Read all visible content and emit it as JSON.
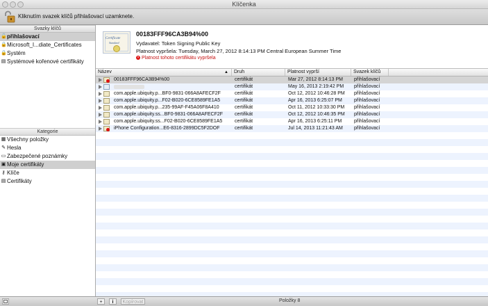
{
  "window": {
    "title": "Klíčenka"
  },
  "toolbar": {
    "lock_text": "Kliknutím svazek klíčů přihlašovací uzamknete."
  },
  "keychains": {
    "header": "Svazky klíčů",
    "items": [
      {
        "label": "přihlašovací",
        "icon": "keychain-lock-icon"
      },
      {
        "label": "Microsoft_I...diate_Certificates",
        "icon": "keychain-lock-icon"
      },
      {
        "label": "Systém",
        "icon": "keychain-lock-icon"
      },
      {
        "label": "Systémové kořenové certifikáty",
        "icon": "folder-icon"
      }
    ]
  },
  "categories": {
    "header": "Kategorie",
    "items": [
      {
        "label": "Všechny položky",
        "icon": "all-items-icon"
      },
      {
        "label": "Hesla",
        "icon": "password-icon"
      },
      {
        "label": "Zabezpečené poznámky",
        "icon": "note-icon"
      },
      {
        "label": "Moje certifikáty",
        "icon": "my-certificates-icon"
      },
      {
        "label": "Klíče",
        "icon": "key-icon"
      },
      {
        "label": "Certifikáty",
        "icon": "certificate-icon"
      }
    ]
  },
  "detail": {
    "cert_word": "Certificate",
    "cert_sub": "Standard",
    "title": "00183FFF96CA3B94%00",
    "issuer": "Vydavatel: Token Signing Public Key",
    "expiry": "Platnost vypršela: Tuesday, March 27, 2012 8:14:13 PM Central European Summer Time",
    "warning": "Platnost tohoto certifikátu vypršela",
    "warning_mark": "×"
  },
  "table": {
    "columns": [
      "Název",
      "Druh",
      "Platnost vyprší",
      "Svazek klíčů"
    ],
    "sort_arrow": "▲",
    "rows": [
      {
        "name": "00183FFF96CA3B94%00",
        "kind": "certifikát",
        "expires": "Mar 27, 2012 8:14:13 PM",
        "keychain": "přihlašovací",
        "invalid": true
      },
      {
        "name": "",
        "kind": "certifikát",
        "expires": "May 16, 2013 2:19:42 PM",
        "keychain": "přihlašovací",
        "invalid": false
      },
      {
        "name": "com.apple.ubiquity.p...BF0-9831-066A8AFECF2F",
        "kind": "certifikát",
        "expires": "Oct 12, 2012 10:46:28 PM",
        "keychain": "přihlašovací",
        "invalid": false
      },
      {
        "name": "com.apple.ubiquity.p...F02-B020-6CE8589FE1A5",
        "kind": "certifikát",
        "expires": "Apr 16, 2013 6:25:07 PM",
        "keychain": "přihlašovací",
        "invalid": false
      },
      {
        "name": "com.apple.ubiquity.p...235-99AF-F45A06F8A410",
        "kind": "certifikát",
        "expires": "Oct 11, 2012 10:33:30 PM",
        "keychain": "přihlašovací",
        "invalid": false
      },
      {
        "name": "com.apple.ubiquity.ss...BF0-9831-066A8AFECF2F",
        "kind": "certifikát",
        "expires": "Oct 12, 2012 10:46:35 PM",
        "keychain": "přihlašovací",
        "invalid": false
      },
      {
        "name": "com.apple.ubiquity.ss...F02-B020-6CE8589FE1A5",
        "kind": "certifikát",
        "expires": "Apr 16, 2013 6:25:11 PM",
        "keychain": "přihlašovací",
        "invalid": false
      },
      {
        "name": "iPhone Configuration...E6-8316-2899DC5F2DOF",
        "kind": "certifikát",
        "expires": "Jul 14, 2013 11:21:43 AM",
        "keychain": "přihlašovací",
        "invalid": true
      }
    ]
  },
  "bottombar": {
    "add": "+",
    "info": "i",
    "copy": "Kopírovat",
    "count": "Položky  8"
  }
}
